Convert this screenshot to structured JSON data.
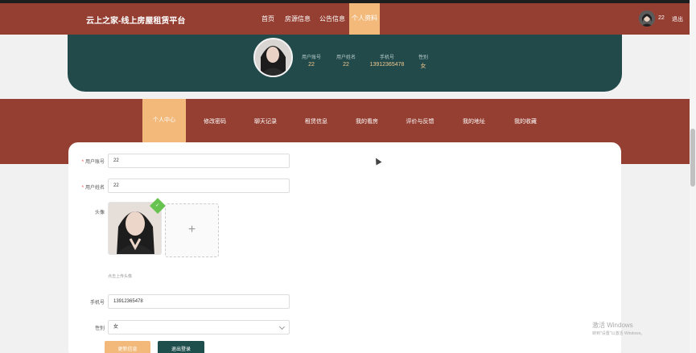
{
  "header": {
    "brand": "云上之家-线上房屋租赁平台",
    "nav": [
      "首页",
      "房源信息",
      "公告信息"
    ],
    "nav_active": "个人资料",
    "user": "22",
    "logout": "退出"
  },
  "profile": {
    "labels": [
      "用户账号",
      "用户姓名",
      "手机号",
      "性别"
    ],
    "values": [
      "22",
      "22",
      "13912365478",
      "女"
    ]
  },
  "tabs": {
    "active": "个人中心",
    "items": [
      "修改密码",
      "聊天记录",
      "租赁信息",
      "我的看房",
      "评价与反馈",
      "我的地址",
      "我的收藏"
    ]
  },
  "form": {
    "account_label": "用户账号",
    "account_value": "22",
    "name_label": "用户姓名",
    "name_value": "22",
    "avatar_label": "头像",
    "avatar_plus": "+",
    "avatar_hint": "点击上传头像",
    "phone_label": "手机号",
    "phone_value": "13912365478",
    "gender_label": "性别",
    "gender_value": "女",
    "update_button": "更新信息",
    "logout_button": "退出登录"
  },
  "watermark": {
    "line1": "激活 Windows",
    "line2": "转到\"设置\"以激活 Windows。"
  },
  "colors": {
    "primary": "#953f32",
    "accent": "#f2b97a",
    "hero": "#234a4b",
    "dark_button": "#1f4f4d"
  }
}
